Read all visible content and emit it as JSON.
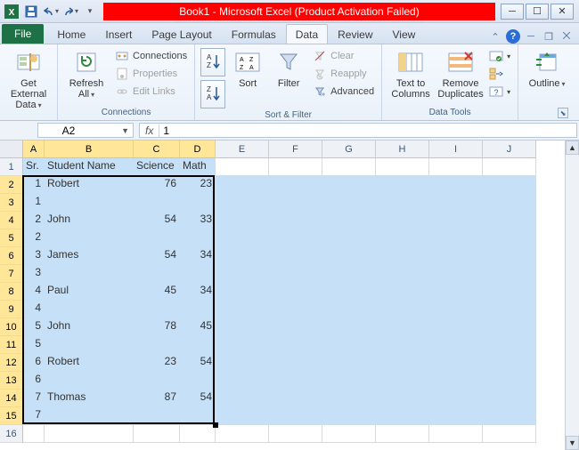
{
  "window": {
    "title": "Book1 - Microsoft Excel (Product Activation Failed)"
  },
  "tabs": {
    "file": "File",
    "home": "Home",
    "insert": "Insert",
    "pagelayout": "Page Layout",
    "formulas": "Formulas",
    "data": "Data",
    "review": "Review",
    "view": "View"
  },
  "ribbon": {
    "get_external": "Get External\nData",
    "refresh": "Refresh\nAll",
    "connections_lbl": "Connections",
    "properties_lbl": "Properties",
    "editlinks_lbl": "Edit Links",
    "group_connections": "Connections",
    "sort": "Sort",
    "filter": "Filter",
    "clear": "Clear",
    "reapply": "Reapply",
    "advanced": "Advanced",
    "group_sortfilter": "Sort & Filter",
    "text_to_cols": "Text to\nColumns",
    "remove_dup": "Remove\nDuplicates",
    "group_datatools": "Data Tools",
    "outline": "Outline",
    "group_outline": "Outline"
  },
  "namebox": "A2",
  "formula": "1",
  "colwidths": {
    "A": 24,
    "B": 100,
    "C": 52,
    "D": 40,
    "E": 60,
    "F": 60,
    "G": 60,
    "H": 60,
    "I": 60,
    "J": 60
  },
  "headers": {
    "A": "Sr.",
    "B": "Student Name",
    "C": "Science",
    "D": "Math"
  },
  "rows": [
    {
      "A": "1",
      "B": "Robert",
      "C": "76",
      "D": "23"
    },
    {
      "A": "1",
      "B": "",
      "C": "",
      "D": ""
    },
    {
      "A": "2",
      "B": "John",
      "C": "54",
      "D": "33"
    },
    {
      "A": "2",
      "B": "",
      "C": "",
      "D": ""
    },
    {
      "A": "3",
      "B": "James",
      "C": "54",
      "D": "34"
    },
    {
      "A": "3",
      "B": "",
      "C": "",
      "D": ""
    },
    {
      "A": "4",
      "B": "Paul",
      "C": "45",
      "D": "34"
    },
    {
      "A": "4",
      "B": "",
      "C": "",
      "D": ""
    },
    {
      "A": "5",
      "B": "John",
      "C": "78",
      "D": "45"
    },
    {
      "A": "5",
      "B": "",
      "C": "",
      "D": ""
    },
    {
      "A": "6",
      "B": "Robert",
      "C": "23",
      "D": "54"
    },
    {
      "A": "6",
      "B": "",
      "C": "",
      "D": ""
    },
    {
      "A": "7",
      "B": "Thomas",
      "C": "87",
      "D": "54"
    },
    {
      "A": "7",
      "B": "",
      "C": "",
      "D": ""
    }
  ],
  "cols": [
    "A",
    "B",
    "C",
    "D",
    "E",
    "F",
    "G",
    "H",
    "I",
    "J"
  ],
  "sel_cols": [
    "A",
    "B",
    "C",
    "D"
  ],
  "sel_rows": [
    2,
    3,
    4,
    5,
    6,
    7,
    8,
    9,
    10,
    11,
    12,
    13,
    14,
    15
  ],
  "visible_rows": 16
}
